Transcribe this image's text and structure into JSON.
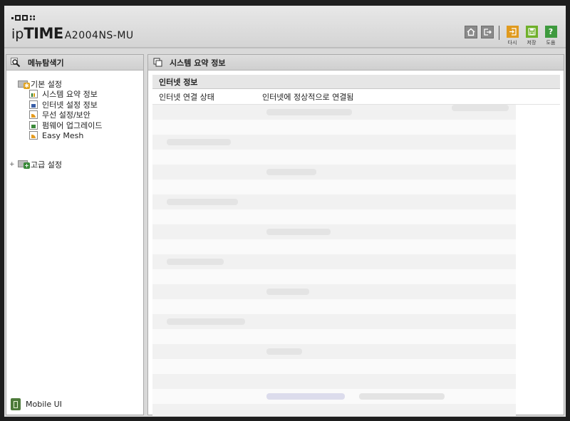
{
  "header": {
    "brand_ip": "ip",
    "brand_time": "TIME",
    "model": "A2004NS-MU",
    "buttons": [
      {
        "name": "reload",
        "label": "다시",
        "color": "#e09a1e",
        "icon": "arrow-in-icon"
      },
      {
        "name": "save",
        "label": "저장",
        "color": "#6fb02a",
        "icon": "floppy-icon"
      },
      {
        "name": "help",
        "label": "도움",
        "color": "#3e9a3e",
        "icon": "question-icon"
      }
    ]
  },
  "sidebar": {
    "title": "메뉴탐색기",
    "groups": [
      {
        "label": "기본 설정",
        "items": [
          {
            "label": "시스템 요약 정보",
            "icon": "chart-icon"
          },
          {
            "label": "인터넷 설정 정보",
            "icon": "network-icon"
          },
          {
            "label": "무선 설정/보안",
            "icon": "wifi-icon"
          },
          {
            "label": "펌웨어 업그레이드",
            "icon": "firmware-icon"
          },
          {
            "label": "Easy Mesh",
            "icon": "wifi-icon"
          }
        ]
      },
      {
        "label": "고급 설정",
        "expander": "+"
      }
    ],
    "mobile_ui": "Mobile UI"
  },
  "main": {
    "title": "시스템 요약 정보",
    "section_title": "인터넷 정보",
    "rows": [
      {
        "key": "인터넷 연결 상태",
        "value": "인터넷에 정상적으로 연결됨"
      }
    ]
  }
}
